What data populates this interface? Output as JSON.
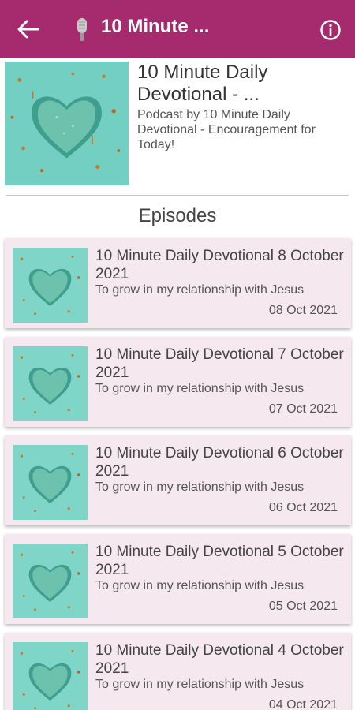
{
  "appbar": {
    "title": "10 Minute ...",
    "back_icon": "arrow-left-icon",
    "podcast_icon": "microphone-icon",
    "info_icon": "info-circle-icon",
    "color": "#a62a6e"
  },
  "podcast": {
    "title": "10 Minute Daily Devotional - ...",
    "subtitle": "Podcast by 10 Minute Daily Devotional - Encouragement for Today!"
  },
  "episodes_heading": "Episodes",
  "episodes": [
    {
      "title": "10 Minute Daily Devotional 8 October 2021",
      "description": "To grow in my relationship with Jesus",
      "date": "08 Oct 2021"
    },
    {
      "title": "10 Minute Daily Devotional 7 October 2021",
      "description": "To grow in my relationship with Jesus",
      "date": "07 Oct 2021"
    },
    {
      "title": "10 Minute Daily Devotional 6 October 2021",
      "description": "To grow in my relationship with Jesus",
      "date": "06 Oct 2021"
    },
    {
      "title": "10 Minute Daily Devotional 5 October 2021",
      "description": "To grow in my relationship with Jesus",
      "date": "05 Oct 2021"
    },
    {
      "title": "10 Minute Daily Devotional 4 October 2021",
      "description": "To grow in my relationship with Jesus",
      "date": "04 Oct 2021"
    }
  ],
  "colors": {
    "card_background": "#f6e8ef",
    "cover_background": "#7fd6c8"
  }
}
